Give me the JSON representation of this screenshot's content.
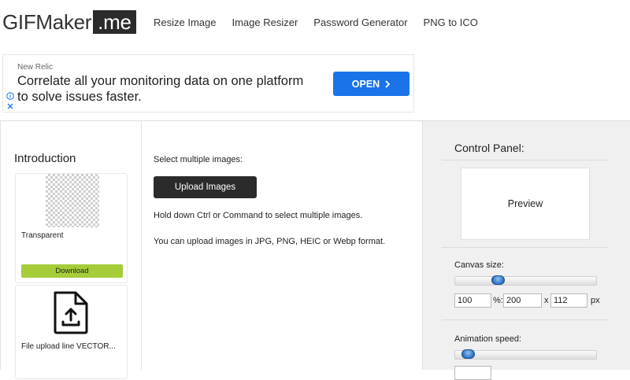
{
  "header": {
    "logo_text": "GIFMaker",
    "logo_box": ".me",
    "nav": [
      "Resize Image",
      "Image Resizer",
      "Password Generator",
      "PNG to ICO"
    ]
  },
  "ad": {
    "brand": "New Relic",
    "headline": "Correlate all your monitoring data on one platform to solve issues faster.",
    "cta": "OPEN",
    "cta_color": "#1a73e8"
  },
  "left": {
    "title": "Introduction",
    "cards": [
      {
        "label": "Transparent",
        "button": "Download",
        "button_color": "#a6cc3a"
      },
      {
        "label": "File upload line VECTOR...",
        "icon": "file-upload-icon"
      }
    ]
  },
  "middle": {
    "select_label": "Select multiple images:",
    "upload_button": "Upload Images",
    "hold_text": "Hold down Ctrl or Command to select multiple images.",
    "formats_text": "You can upload images in JPG, PNG, HEIC or Webp format."
  },
  "control_panel": {
    "title": "Control Panel:",
    "preview": "Preview",
    "canvas_size": {
      "label": "Canvas size:",
      "slider_level": 0.28,
      "percent": "100",
      "percent_suffix": "%:",
      "width": "200",
      "x_sep": "x",
      "height": "112",
      "unit": "px"
    },
    "animation_speed": {
      "label": "Animation speed:",
      "slider_level": 0.05
    }
  }
}
